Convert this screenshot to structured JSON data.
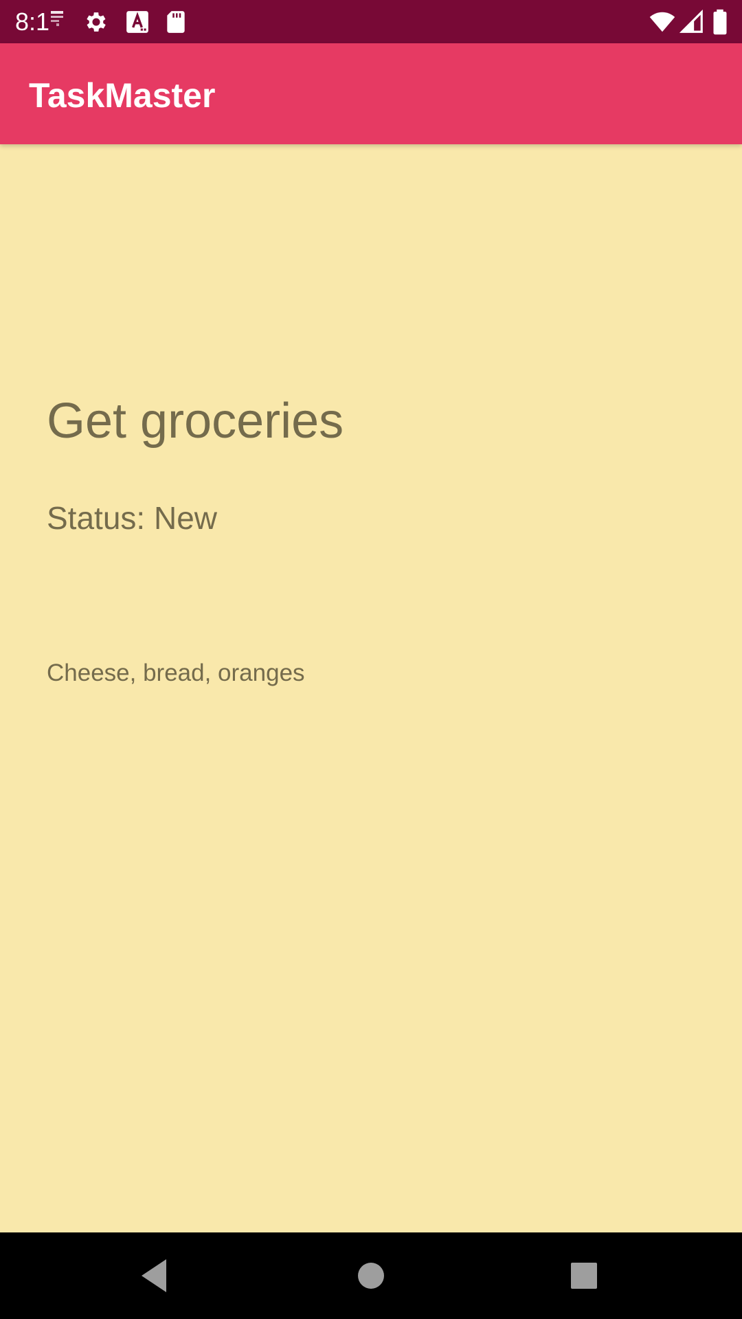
{
  "status_bar": {
    "time": "8:1",
    "icons": [
      "notification-small-icon",
      "gear-icon",
      "text-a-icon",
      "sd-card-icon",
      "wifi-icon",
      "cell-signal-icon",
      "battery-icon"
    ]
  },
  "app_bar": {
    "title": "TaskMaster"
  },
  "task": {
    "title": "Get groceries",
    "status": "Status: New",
    "description": "Cheese, bread, oranges"
  },
  "nav_bar": {
    "icons": [
      "back-icon",
      "home-icon",
      "recents-icon"
    ]
  },
  "colors": {
    "status_bar": "#780936",
    "app_bar": "#e63a63",
    "background": "#f9e8ab",
    "text": "#746b4c",
    "nav_bar": "#000000"
  }
}
